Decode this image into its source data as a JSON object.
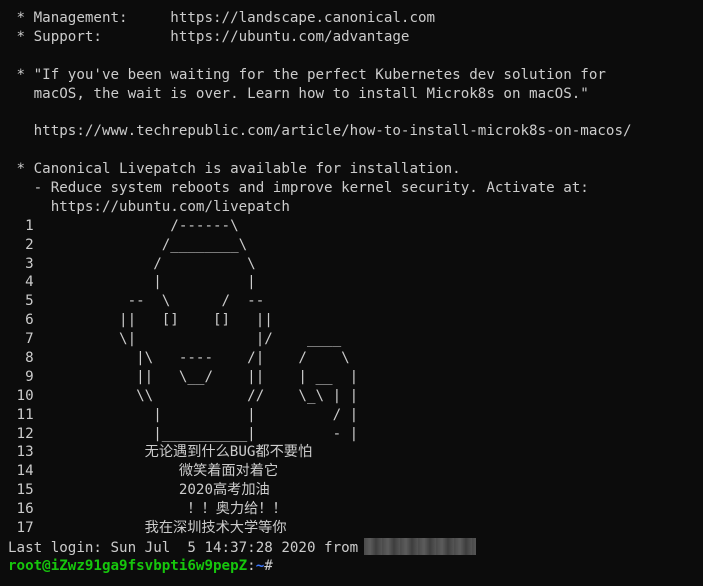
{
  "motd": {
    "management": " * Management:     https://landscape.canonical.com",
    "support": " * Support:        https://ubuntu.com/advantage",
    "quote_1": " * \"If you've been waiting for the perfect Kubernetes dev solution for",
    "quote_2": "   macOS, the wait is over. Learn how to install Microk8s on macOS.\"",
    "article_url": "   https://www.techrepublic.com/article/how-to-install-microk8s-on-macos/",
    "livepatch_1": " * Canonical Livepatch is available for installation.",
    "livepatch_2": "   - Reduce system reboots and improve kernel security. Activate at:",
    "livepatch_3": "     https://ubuntu.com/livepatch"
  },
  "ascii_art": [
    "  1                /------\\",
    "  2               /________\\",
    "  3              /          \\",
    "  4              |          |",
    "  5           --  \\      /  --",
    "  6          ||   []    []   ||",
    "  7          \\|              |/    ____",
    "  8            |\\   ----    /|    /    \\",
    "  9            ||   \\__/    ||    | __  |",
    " 10            \\\\           //    \\_\\ | |",
    " 11              |          |         / |",
    " 12              |__________|         - |",
    " 13             无论遇到什么BUG都不要怕",
    " 14                 微笑着面对着它",
    " 15                 2020高考加油",
    " 16                  ！！奥力给！！",
    " 17             我在深圳技术大学等你"
  ],
  "last_login": {
    "text": "Last login: Sun Jul  5 14:37:28 2020 from"
  },
  "prompt": {
    "user_host": "root@iZwz91ga9fsvbpti6w9pepZ",
    "separator": ":",
    "path": "~",
    "symbol": "#"
  },
  "colors": {
    "background": "#0c0c0c",
    "foreground": "#cccccc",
    "prompt_user": "#16c60c",
    "prompt_path": "#3b78ff"
  }
}
